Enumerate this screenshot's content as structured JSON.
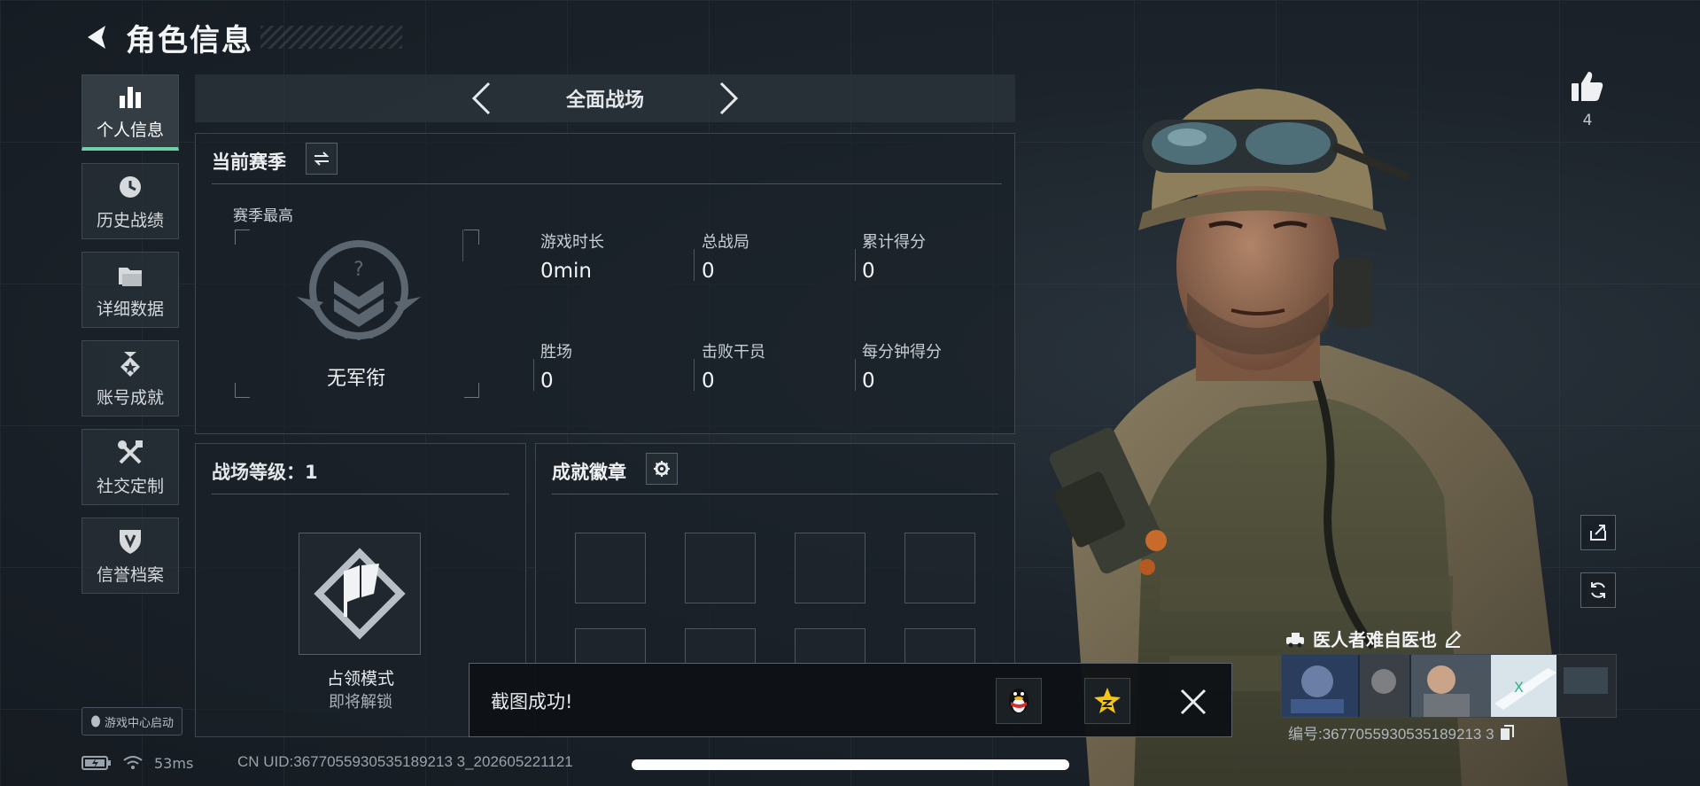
{
  "header": {
    "title": "角色信息"
  },
  "nav": {
    "items": [
      {
        "label": "个人信息",
        "icon": "bar-chart-icon",
        "active": true
      },
      {
        "label": "历史战绩",
        "icon": "clock-icon",
        "active": false
      },
      {
        "label": "详细数据",
        "icon": "folder-icon",
        "active": false
      },
      {
        "label": "账号成就",
        "icon": "medal-icon",
        "active": false
      },
      {
        "label": "社交定制",
        "icon": "tools-icon",
        "active": false
      },
      {
        "label": "信誉档案",
        "icon": "shield-icon",
        "active": false
      }
    ]
  },
  "mode": {
    "name": "全面战场"
  },
  "season": {
    "title": "当前赛季",
    "best_label": "赛季最高",
    "rank_name": "无军衔",
    "stats": [
      {
        "label": "游戏时长",
        "value": "0min"
      },
      {
        "label": "总战局",
        "value": "0"
      },
      {
        "label": "累计得分",
        "value": "0"
      },
      {
        "label": "胜场",
        "value": "0"
      },
      {
        "label": "击败干员",
        "value": "0"
      },
      {
        "label": "每分钟得分",
        "value": "0"
      }
    ]
  },
  "level": {
    "title": "战场等级：1",
    "mode_label": "占领模式",
    "mode_sub": "即将解锁"
  },
  "badges": {
    "title": "成就徽章"
  },
  "game_center": {
    "label": "游戏中心启动"
  },
  "status": {
    "ping": "53ms",
    "uid": "CN UID:3677055930535189213 3_202605221121"
  },
  "toast": {
    "text": "截图成功!"
  },
  "like": {
    "count": "4"
  },
  "player": {
    "name": "医人者难自医也",
    "id": "编号:3677055930535189213 3"
  },
  "colors": {
    "accent": "#6fd0a6",
    "background": "#1a2129",
    "panel_border": "#3b4650"
  }
}
